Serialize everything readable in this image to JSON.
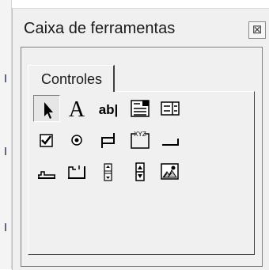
{
  "window": {
    "title": "Caixa de ferramentas",
    "close_glyph": "⊠"
  },
  "tabs": [
    {
      "label": "Controles"
    }
  ],
  "tools": [
    {
      "name": "select-objects-icon",
      "glyph": "",
      "selected": true
    },
    {
      "name": "label-icon",
      "glyph": "A"
    },
    {
      "name": "textbox-icon",
      "glyph": "ab|"
    },
    {
      "name": "combobox-icon",
      "glyph": ""
    },
    {
      "name": "listbox-icon",
      "glyph": ""
    },
    {
      "name": "checkbox-icon",
      "glyph": ""
    },
    {
      "name": "optionbutton-icon",
      "glyph": ""
    },
    {
      "name": "togglebutton-icon",
      "glyph": ""
    },
    {
      "name": "frame-icon",
      "glyph": "XYZ"
    },
    {
      "name": "commandbutton-icon",
      "glyph": ""
    },
    {
      "name": "tabstrip-icon",
      "glyph": ""
    },
    {
      "name": "multipage-icon",
      "glyph": ""
    },
    {
      "name": "scrollbar-icon",
      "glyph": ""
    },
    {
      "name": "spinbutton-icon",
      "glyph": ""
    },
    {
      "name": "image-icon",
      "glyph": ""
    }
  ]
}
